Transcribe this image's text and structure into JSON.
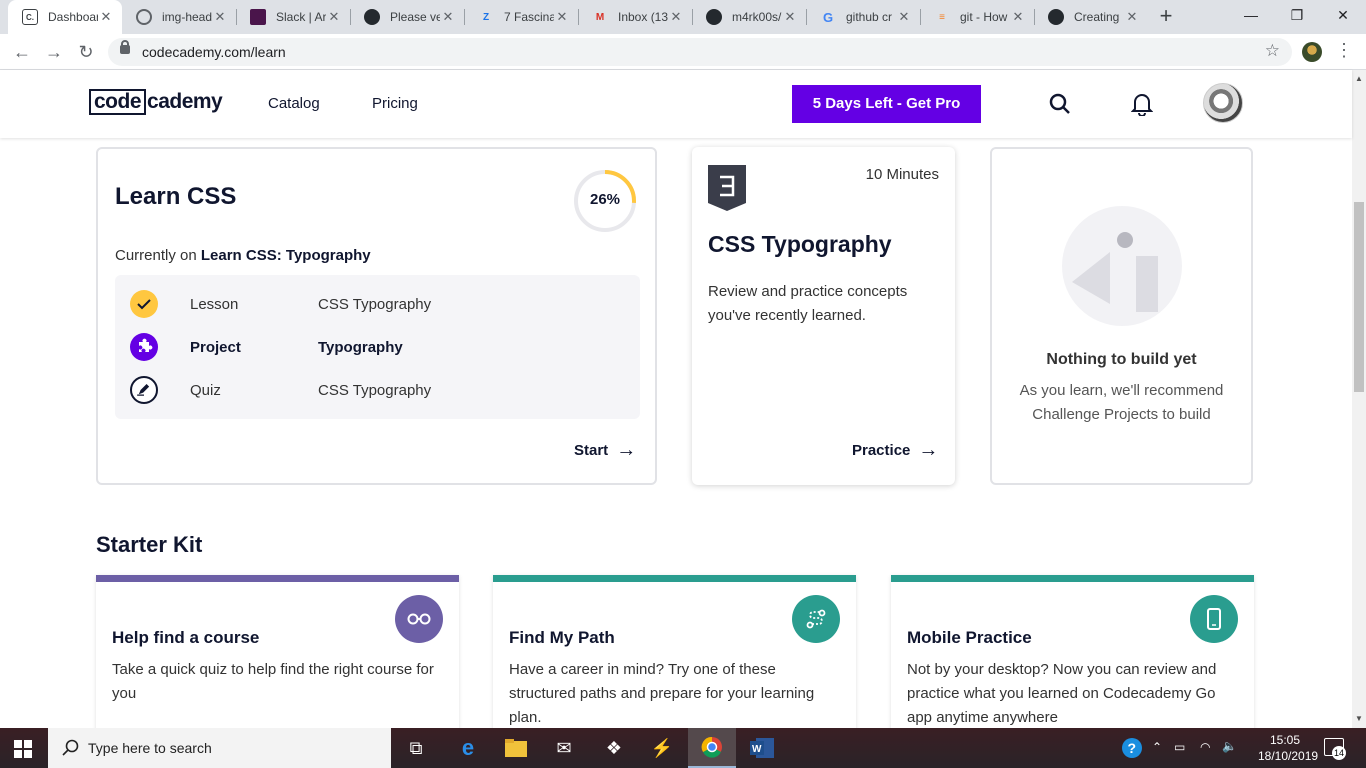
{
  "browser": {
    "tabs": [
      {
        "title": "Dashboar",
        "icon": "codecademy-icon",
        "active": true
      },
      {
        "title": "img-head",
        "icon": "globe-icon"
      },
      {
        "title": "Slack | Ar",
        "icon": "slack-icon"
      },
      {
        "title": "Please ve",
        "icon": "github-icon"
      },
      {
        "title": "7 Fascina",
        "icon": "zapier-icon"
      },
      {
        "title": "Inbox (13",
        "icon": "gmail-icon"
      },
      {
        "title": "m4rk00s/",
        "icon": "github-icon"
      },
      {
        "title": "github cr",
        "icon": "google-icon"
      },
      {
        "title": "git - How",
        "icon": "stackoverflow-icon"
      },
      {
        "title": "Creating",
        "icon": "github-icon"
      }
    ],
    "url": "codecademy.com/learn"
  },
  "header": {
    "logo_left": "code",
    "logo_right": "cademy",
    "nav": [
      "Catalog",
      "Pricing"
    ],
    "pro_button": "5 Days Left - Get Pro"
  },
  "course": {
    "title": "Learn CSS",
    "progress_percent": 26,
    "progress_label": "26%",
    "currently_prefix": "Currently on ",
    "currently_course": "Learn CSS: Typography",
    "steps": [
      {
        "kind": "Lesson",
        "name": "CSS Typography",
        "status": "complete"
      },
      {
        "kind": "Project",
        "name": "Typography",
        "status": "current"
      },
      {
        "kind": "Quiz",
        "name": "CSS Typography",
        "status": "upcoming"
      }
    ],
    "action": "Start"
  },
  "practice": {
    "duration": "10 Minutes",
    "title": "CSS Typography",
    "description": "Review and practice concepts you've recently learned.",
    "action": "Practice"
  },
  "build": {
    "title": "Nothing to build yet",
    "description": "As you learn, we'll recommend Challenge Projects to build"
  },
  "starter_kit": {
    "title": "Starter Kit",
    "cards": [
      {
        "title": "Help find a course",
        "description": "Take a quick quiz to help find the right course for you",
        "color": "#6c5fa6",
        "icon": "glasses-icon"
      },
      {
        "title": "Find My Path",
        "description": "Have a career in mind? Try one of these structured paths and prepare for your learning plan.",
        "color": "#2a9d8f",
        "icon": "path-icon"
      },
      {
        "title": "Mobile Practice",
        "description": "Not by your desktop? Now you can review and practice what you learned on Codecademy Go app anytime anywhere",
        "color": "#2a9d8f",
        "icon": "mobile-icon"
      }
    ]
  },
  "taskbar": {
    "search_placeholder": "Type here to search",
    "time": "15:05",
    "date": "18/10/2019",
    "notifications": "14"
  },
  "colors": {
    "brand_purple": "#6400e4",
    "progress_yellow": "#ffc740",
    "navy": "#10162f"
  }
}
